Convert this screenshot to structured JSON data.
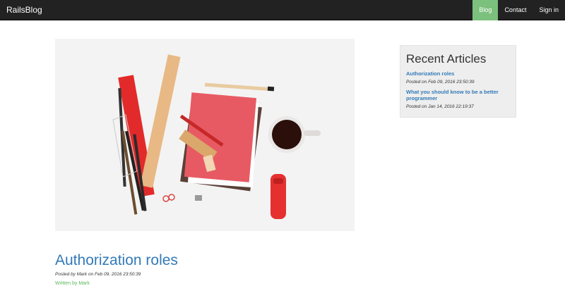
{
  "navbar": {
    "brand": "RailsBlog",
    "items": [
      {
        "label": "Blog",
        "active": true
      },
      {
        "label": "Contact",
        "active": false
      },
      {
        "label": "Sign in",
        "active": false
      }
    ]
  },
  "sidebar": {
    "title": "Recent Articles",
    "articles": [
      {
        "title": "Authorization roles",
        "meta": "Posted on Feb 09, 2016 23:50:39"
      },
      {
        "title": "What you should know to be a better programmer",
        "meta": "Posted on Jan 14, 2016 22:19:37"
      }
    ]
  },
  "post": {
    "title": "Authorization roles",
    "meta": "Posted by Mark on Feb 09, 2016 23:50:39",
    "author": "Written by Mark"
  },
  "colors": {
    "navbar": "#222222",
    "active_nav": "#7bc07d",
    "link": "#337ab7",
    "author": "#5cb85c"
  }
}
